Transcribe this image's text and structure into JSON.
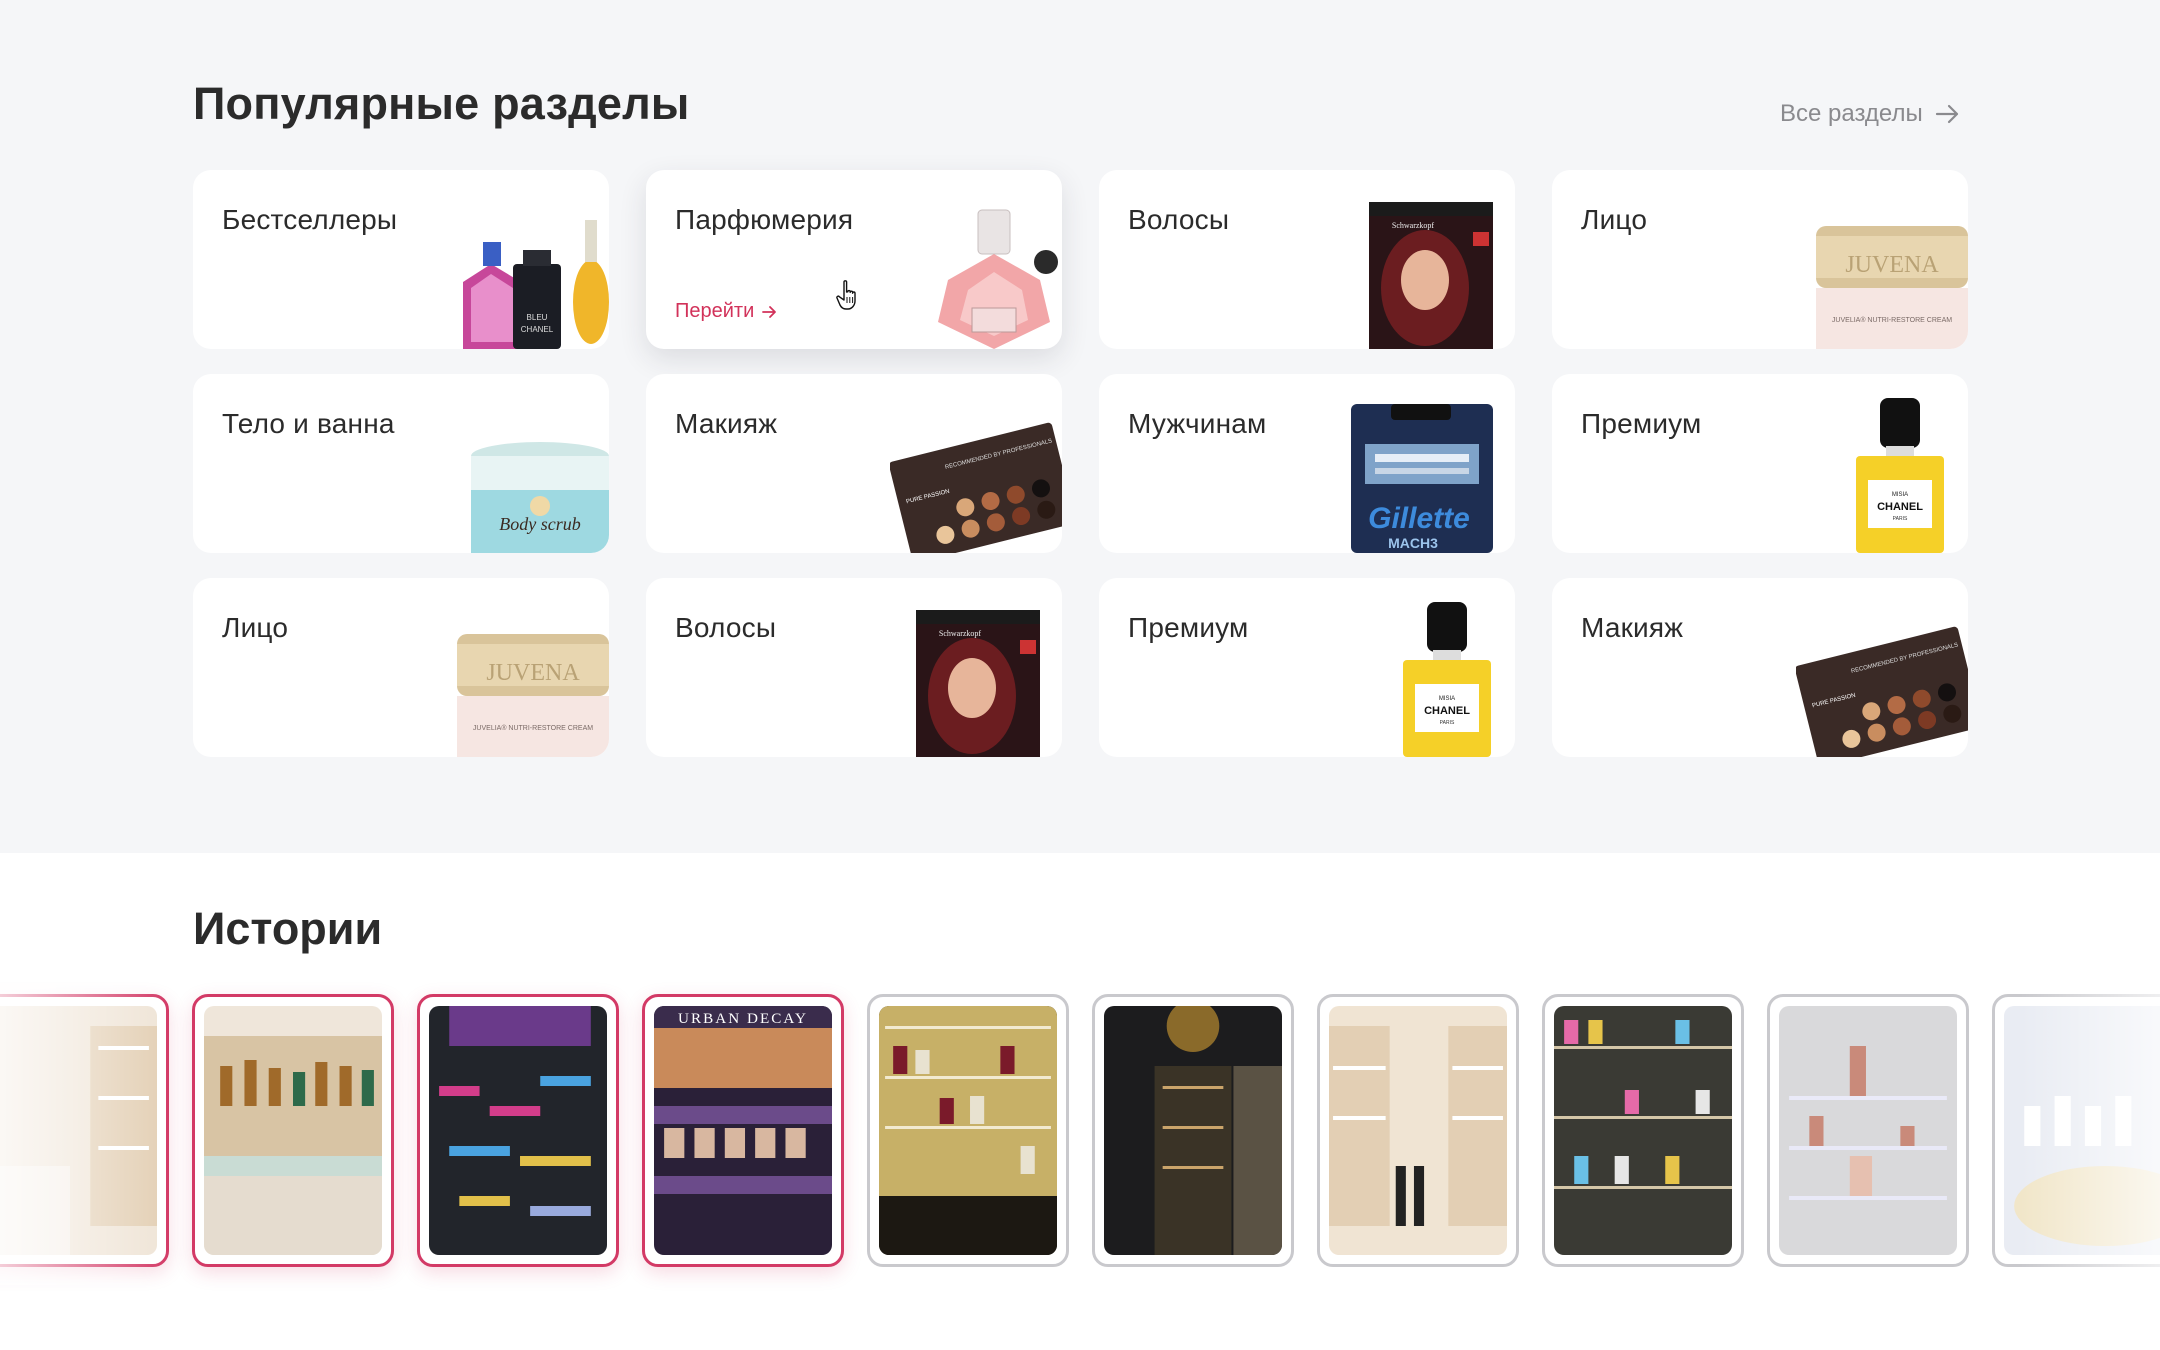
{
  "popular": {
    "title": "Популярные разделы",
    "all_label": "Все разделы",
    "go_label": "Перейти",
    "categories": [
      {
        "label": "Бестселлеры",
        "icon": "perfume-bottles-image"
      },
      {
        "label": "Парфюмерия",
        "icon": "pink-perfume-image"
      },
      {
        "label": "Волосы",
        "icon": "hair-dye-box-image"
      },
      {
        "label": "Лицо",
        "icon": "face-cream-jar-image"
      },
      {
        "label": "Тело и ванна",
        "icon": "body-scrub-jar-image"
      },
      {
        "label": "Макияж",
        "icon": "eyeshadow-palette-image"
      },
      {
        "label": "Мужчинам",
        "icon": "razor-pack-image"
      },
      {
        "label": "Премиум",
        "icon": "chanel-bottle-image"
      },
      {
        "label": "Лицо",
        "icon": "face-cream-jar-image"
      },
      {
        "label": "Волосы",
        "icon": "hair-dye-box-image"
      },
      {
        "label": "Премиум",
        "icon": "chanel-bottle-image"
      },
      {
        "label": "Макияж",
        "icon": "eyeshadow-palette-image"
      }
    ],
    "product_text": {
      "chanel_line1": "BLEU",
      "chanel_line2": "CHANEL",
      "misia": "MISIA",
      "chanel": "CHANEL",
      "paris": "PARIS",
      "juvena": "JUVENA",
      "juvena_sub": "JUVELIA® NUTRI-RESTORE CREAM",
      "body_scrub": "Body scrub",
      "gillette": "Gillette",
      "mach3": "MACH3",
      "palette_top": "RECOMMENDED BY PROFESSIONALS",
      "pure_passion": "PURE PASSION",
      "schwarzkopf": "Schwarzkopf"
    }
  },
  "stories": {
    "title": "Истории",
    "items": [
      {
        "name": "story-boutique-white",
        "seen": false
      },
      {
        "name": "story-perfume-counter",
        "seen": false
      },
      {
        "name": "story-makeup-stand",
        "seen": false
      },
      {
        "name": "story-urban-decay",
        "seen": false,
        "label": "URBAN DECAY"
      },
      {
        "name": "story-shelves-gold",
        "seen": true
      },
      {
        "name": "story-dark-boutique",
        "seen": true
      },
      {
        "name": "story-white-shelves",
        "seen": true
      },
      {
        "name": "story-colorful-bottles",
        "seen": true
      },
      {
        "name": "story-glass-stand",
        "seen": true
      },
      {
        "name": "story-round-display",
        "seen": true
      }
    ]
  },
  "colors": {
    "accent": "#d2325a",
    "story_unseen": "#d33a66",
    "story_seen": "#c9c9cd",
    "section_bg": "#f5f6f8"
  }
}
